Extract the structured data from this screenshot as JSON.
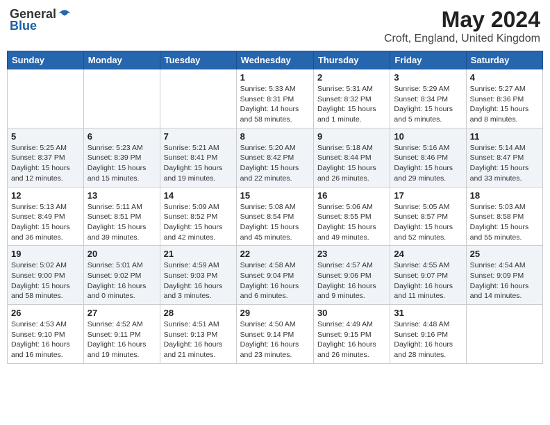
{
  "header": {
    "logo_general": "General",
    "logo_blue": "Blue",
    "month_year": "May 2024",
    "location": "Croft, England, United Kingdom"
  },
  "weekdays": [
    "Sunday",
    "Monday",
    "Tuesday",
    "Wednesday",
    "Thursday",
    "Friday",
    "Saturday"
  ],
  "weeks": [
    [
      {
        "day": "",
        "info": ""
      },
      {
        "day": "",
        "info": ""
      },
      {
        "day": "",
        "info": ""
      },
      {
        "day": "1",
        "info": "Sunrise: 5:33 AM\nSunset: 8:31 PM\nDaylight: 14 hours\nand 58 minutes."
      },
      {
        "day": "2",
        "info": "Sunrise: 5:31 AM\nSunset: 8:32 PM\nDaylight: 15 hours\nand 1 minute."
      },
      {
        "day": "3",
        "info": "Sunrise: 5:29 AM\nSunset: 8:34 PM\nDaylight: 15 hours\nand 5 minutes."
      },
      {
        "day": "4",
        "info": "Sunrise: 5:27 AM\nSunset: 8:36 PM\nDaylight: 15 hours\nand 8 minutes."
      }
    ],
    [
      {
        "day": "5",
        "info": "Sunrise: 5:25 AM\nSunset: 8:37 PM\nDaylight: 15 hours\nand 12 minutes."
      },
      {
        "day": "6",
        "info": "Sunrise: 5:23 AM\nSunset: 8:39 PM\nDaylight: 15 hours\nand 15 minutes."
      },
      {
        "day": "7",
        "info": "Sunrise: 5:21 AM\nSunset: 8:41 PM\nDaylight: 15 hours\nand 19 minutes."
      },
      {
        "day": "8",
        "info": "Sunrise: 5:20 AM\nSunset: 8:42 PM\nDaylight: 15 hours\nand 22 minutes."
      },
      {
        "day": "9",
        "info": "Sunrise: 5:18 AM\nSunset: 8:44 PM\nDaylight: 15 hours\nand 26 minutes."
      },
      {
        "day": "10",
        "info": "Sunrise: 5:16 AM\nSunset: 8:46 PM\nDaylight: 15 hours\nand 29 minutes."
      },
      {
        "day": "11",
        "info": "Sunrise: 5:14 AM\nSunset: 8:47 PM\nDaylight: 15 hours\nand 33 minutes."
      }
    ],
    [
      {
        "day": "12",
        "info": "Sunrise: 5:13 AM\nSunset: 8:49 PM\nDaylight: 15 hours\nand 36 minutes."
      },
      {
        "day": "13",
        "info": "Sunrise: 5:11 AM\nSunset: 8:51 PM\nDaylight: 15 hours\nand 39 minutes."
      },
      {
        "day": "14",
        "info": "Sunrise: 5:09 AM\nSunset: 8:52 PM\nDaylight: 15 hours\nand 42 minutes."
      },
      {
        "day": "15",
        "info": "Sunrise: 5:08 AM\nSunset: 8:54 PM\nDaylight: 15 hours\nand 45 minutes."
      },
      {
        "day": "16",
        "info": "Sunrise: 5:06 AM\nSunset: 8:55 PM\nDaylight: 15 hours\nand 49 minutes."
      },
      {
        "day": "17",
        "info": "Sunrise: 5:05 AM\nSunset: 8:57 PM\nDaylight: 15 hours\nand 52 minutes."
      },
      {
        "day": "18",
        "info": "Sunrise: 5:03 AM\nSunset: 8:58 PM\nDaylight: 15 hours\nand 55 minutes."
      }
    ],
    [
      {
        "day": "19",
        "info": "Sunrise: 5:02 AM\nSunset: 9:00 PM\nDaylight: 15 hours\nand 58 minutes."
      },
      {
        "day": "20",
        "info": "Sunrise: 5:01 AM\nSunset: 9:02 PM\nDaylight: 16 hours\nand 0 minutes."
      },
      {
        "day": "21",
        "info": "Sunrise: 4:59 AM\nSunset: 9:03 PM\nDaylight: 16 hours\nand 3 minutes."
      },
      {
        "day": "22",
        "info": "Sunrise: 4:58 AM\nSunset: 9:04 PM\nDaylight: 16 hours\nand 6 minutes."
      },
      {
        "day": "23",
        "info": "Sunrise: 4:57 AM\nSunset: 9:06 PM\nDaylight: 16 hours\nand 9 minutes."
      },
      {
        "day": "24",
        "info": "Sunrise: 4:55 AM\nSunset: 9:07 PM\nDaylight: 16 hours\nand 11 minutes."
      },
      {
        "day": "25",
        "info": "Sunrise: 4:54 AM\nSunset: 9:09 PM\nDaylight: 16 hours\nand 14 minutes."
      }
    ],
    [
      {
        "day": "26",
        "info": "Sunrise: 4:53 AM\nSunset: 9:10 PM\nDaylight: 16 hours\nand 16 minutes."
      },
      {
        "day": "27",
        "info": "Sunrise: 4:52 AM\nSunset: 9:11 PM\nDaylight: 16 hours\nand 19 minutes."
      },
      {
        "day": "28",
        "info": "Sunrise: 4:51 AM\nSunset: 9:13 PM\nDaylight: 16 hours\nand 21 minutes."
      },
      {
        "day": "29",
        "info": "Sunrise: 4:50 AM\nSunset: 9:14 PM\nDaylight: 16 hours\nand 23 minutes."
      },
      {
        "day": "30",
        "info": "Sunrise: 4:49 AM\nSunset: 9:15 PM\nDaylight: 16 hours\nand 26 minutes."
      },
      {
        "day": "31",
        "info": "Sunrise: 4:48 AM\nSunset: 9:16 PM\nDaylight: 16 hours\nand 28 minutes."
      },
      {
        "day": "",
        "info": ""
      }
    ]
  ]
}
